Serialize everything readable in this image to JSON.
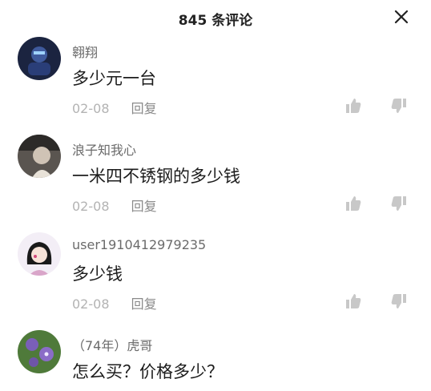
{
  "header": {
    "title": "845 条评论"
  },
  "comments": [
    {
      "user": "翱翔",
      "text": "多少元一台",
      "date": "02-08",
      "reply": "回复"
    },
    {
      "user": "浪子知我心",
      "text": "一米四不锈钢的多少钱",
      "date": "02-08",
      "reply": "回复"
    },
    {
      "user": "user1910412979235",
      "text": "多少钱",
      "date": "02-08",
      "reply": "回复"
    },
    {
      "user": "（74年）虎哥",
      "text": "怎么买？价格多少？"
    }
  ],
  "icons": {
    "close": "close-icon",
    "like": "thumbs-up-icon",
    "dislike": "thumbs-down-icon"
  },
  "colors": {
    "text_primary": "#1c1c1c",
    "text_secondary": "#6b6b6b",
    "text_muted": "#b3b3b3",
    "icon": "#c8c8c8"
  }
}
